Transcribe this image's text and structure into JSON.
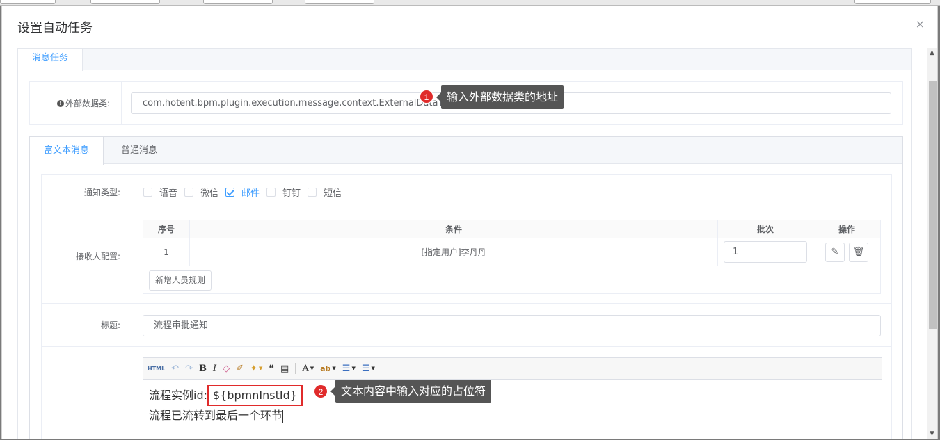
{
  "modal": {
    "title": "设置自动任务",
    "close_icon": "×"
  },
  "outer_tabs": [
    {
      "label": "消息任务",
      "active": true
    }
  ],
  "external": {
    "label": "外部数据类:",
    "value": "com.hotent.bpm.plugin.execution.message.context.ExternalDataTest"
  },
  "annotations": [
    {
      "number": "1",
      "text": "输入外部数据类的地址"
    },
    {
      "number": "2",
      "text": "文本内容中输入对应的占位符"
    }
  ],
  "inner_tabs": [
    {
      "label": "富文本消息",
      "active": true
    },
    {
      "label": "普通消息",
      "active": false
    }
  ],
  "notify": {
    "label": "通知类型:",
    "options": [
      {
        "label": "语音",
        "checked": false
      },
      {
        "label": "微信",
        "checked": false
      },
      {
        "label": "邮件",
        "checked": true
      },
      {
        "label": "钉钉",
        "checked": false
      },
      {
        "label": "短信",
        "checked": false
      }
    ]
  },
  "receivers": {
    "label": "接收人配置:",
    "columns": [
      "序号",
      "条件",
      "批次",
      "操作"
    ],
    "rows": [
      {
        "index": "1",
        "condition": "[指定用户]李丹丹",
        "batch": "1"
      }
    ],
    "add_button": "新增人员规则"
  },
  "title_field": {
    "label": "标题:",
    "value": "流程审批通知"
  },
  "editor": {
    "toolbar": [
      "HTML",
      "undo-icon",
      "redo-icon",
      "B",
      "I",
      "eraser-icon",
      "brush-icon",
      "magic-icon",
      "quote-icon",
      "paste-icon",
      "A",
      "ab",
      "ordered-list-icon",
      "unordered-list-icon"
    ],
    "line1_prefix": "流程实例id:",
    "line1_placeholder": "${bpmnInstId}",
    "line2": "流程已流转到最后一个环节"
  },
  "colors": {
    "accent": "#409eff",
    "annotation_red": "#e02b2b",
    "tooltip_bg": "#555555"
  }
}
